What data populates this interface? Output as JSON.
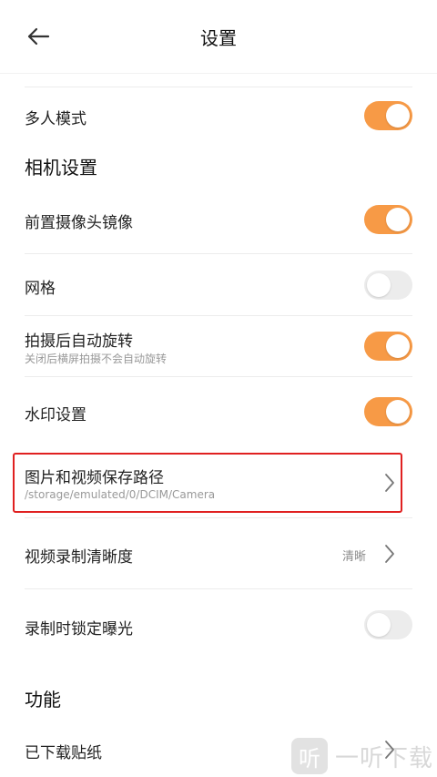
{
  "header": {
    "title": "设置"
  },
  "rows": {
    "multi_person": {
      "label": "多人模式",
      "toggle": true
    },
    "front_mirror": {
      "label": "前置摄像头镜像",
      "toggle": true
    },
    "grid": {
      "label": "网格",
      "toggle": false
    },
    "auto_rotate": {
      "label": "拍摄后自动旋转",
      "sublabel": "关闭后横屏拍摄不会自动旋转",
      "toggle": true
    },
    "watermark": {
      "label": "水印设置",
      "toggle": true
    },
    "save_path": {
      "label": "图片和视频保存路径",
      "sublabel": "/storage/emulated/0/DCIM/Camera"
    },
    "video_quality": {
      "label": "视频录制清晰度",
      "value": "清晰"
    },
    "lock_exposure": {
      "label": "录制时锁定曝光",
      "toggle": false
    },
    "downloaded_stickers": {
      "label": "已下载贴纸"
    }
  },
  "sections": {
    "camera_settings": "相机设置",
    "features": "功能"
  },
  "watermark_overlay": {
    "logo_char": "听",
    "text": "一听下载"
  },
  "colors": {
    "accent": "#f79a46",
    "toggle_off": "#ececec",
    "highlight": "#e02020"
  },
  "icons": {
    "back": "arrow-left-icon",
    "chevron": "chevron-right-icon"
  }
}
